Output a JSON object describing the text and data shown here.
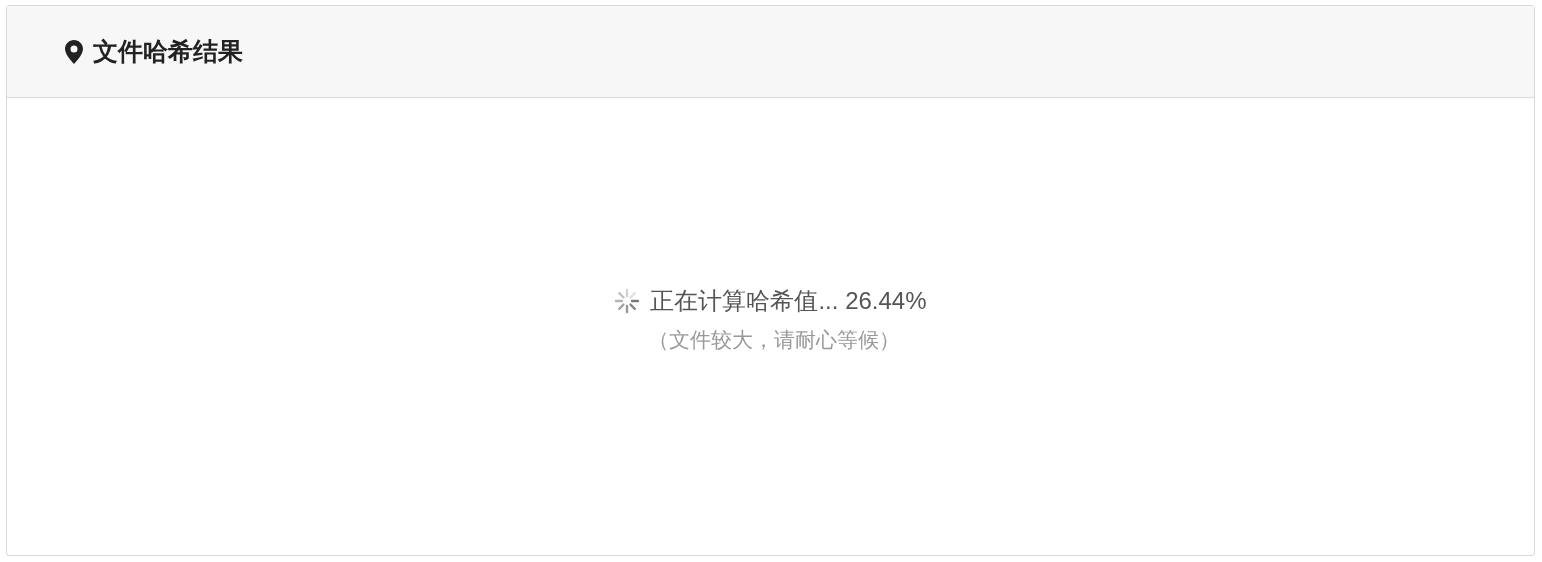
{
  "card": {
    "title": "文件哈希结果"
  },
  "progress": {
    "message": "正在计算哈希值... 26.44%",
    "note": "（文件较大，请耐心等候）"
  }
}
